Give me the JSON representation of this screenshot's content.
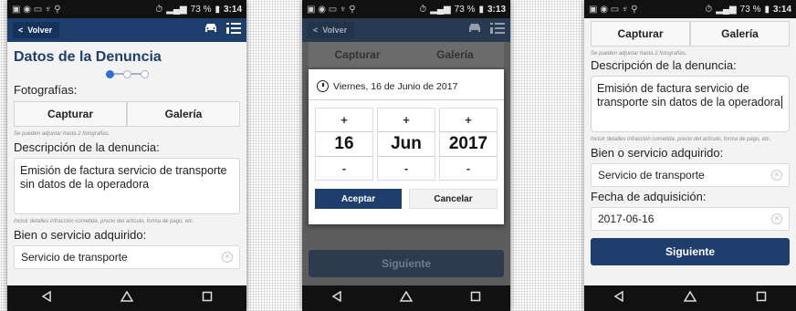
{
  "status": {
    "battery": "73 %",
    "time1": "3:14",
    "time2": "3:13",
    "time3": "3:14"
  },
  "appbar": {
    "back_label": "Volver",
    "icons": [
      "car-icon",
      "menu-list-icon"
    ]
  },
  "screen1": {
    "title": "Datos de la Denuncia",
    "photos_label": "Fotografías:",
    "capture_label": "Capturar",
    "gallery_label": "Galería",
    "photos_hint": "Se pueden adjuntar hasta 2 fotografías.",
    "description_label": "Descripción de la denuncia:",
    "description_value": "Emisión de factura servicio de transporte sin datos de la operadora",
    "description_hint": "Incluir detalles infracción cometida, precio del artículo, forma de pago, etc.",
    "product_label": "Bien o servicio adquirido:",
    "product_value": "Servicio de transporte"
  },
  "screen2": {
    "capture_label": "Capturar",
    "gallery_label": "Galería",
    "date_header": "Viernes, 16 de Junio de 2017",
    "day": "16",
    "month": "Jun",
    "year": "2017",
    "plus": "+",
    "minus": "-",
    "accept_label": "Aceptar",
    "cancel_label": "Cancelar",
    "next_label": "Siguiente"
  },
  "screen3": {
    "capture_label": "Capturar",
    "gallery_label": "Galería",
    "photos_hint": "Se pueden adjuntar hasta 2 fotografías.",
    "description_label": "Descripción de la denuncia:",
    "description_value": "Emisión de factura servicio de transporte sin datos de la operadora",
    "description_hint": "Incluir detalles infracción cometida, precio del artículo, forma de pago, etc.",
    "product_label": "Bien o servicio adquirido:",
    "product_value": "Servicio de transporte",
    "date_label": "Fecha de adquisición:",
    "date_value": "2017-06-16",
    "next_label": "Siguiente"
  },
  "colors": {
    "primary": "#1e3f6e",
    "step_active": "#2d6fd4"
  }
}
